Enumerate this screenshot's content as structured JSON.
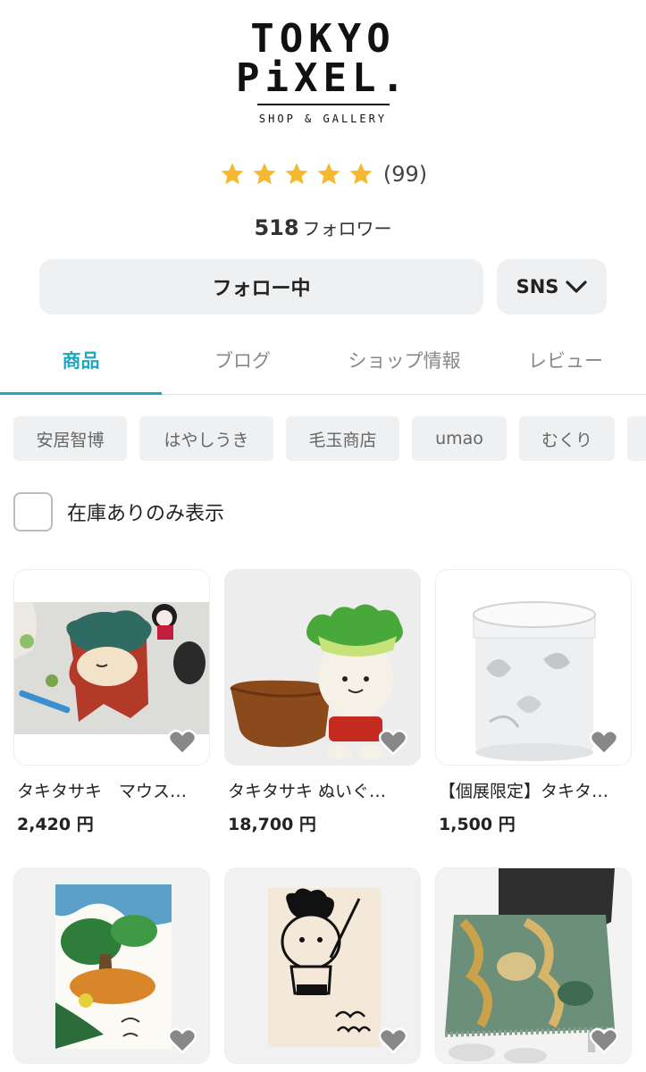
{
  "shop": {
    "logo_line1": "TOKYO",
    "logo_line2": "PiXEL.",
    "logo_sub": "SHOP & GALLERY"
  },
  "rating": {
    "stars": 5,
    "count_text": "(99)",
    "star_color": "#f5b82e"
  },
  "followers": {
    "count": "518",
    "label": "フォロワー"
  },
  "buttons": {
    "follow_label": "フォロー中",
    "sns_label": "SNS",
    "sns_icon": "chevron-down-icon"
  },
  "tabs": [
    {
      "label": "商品",
      "active": true
    },
    {
      "label": "ブログ",
      "active": false
    },
    {
      "label": "ショップ情報",
      "active": false
    },
    {
      "label": "レビュー",
      "active": false
    }
  ],
  "accent_color": "#1aaac0",
  "chips": [
    "安居智博",
    "はやしうき",
    "毛玉商店",
    "umao",
    "むくり"
  ],
  "stock_filter": {
    "label": "在庫ありのみ表示",
    "checked": false
  },
  "products": [
    {
      "name": "タキタサキ　マウス…",
      "price": "2,420 円"
    },
    {
      "name": "タキタサキ ぬいぐ…",
      "price": "18,700 円"
    },
    {
      "name": "【個展限定】タキタ…",
      "price": "1,500 円"
    },
    {
      "name": "",
      "price": ""
    },
    {
      "name": "",
      "price": ""
    },
    {
      "name": "",
      "price": ""
    }
  ]
}
